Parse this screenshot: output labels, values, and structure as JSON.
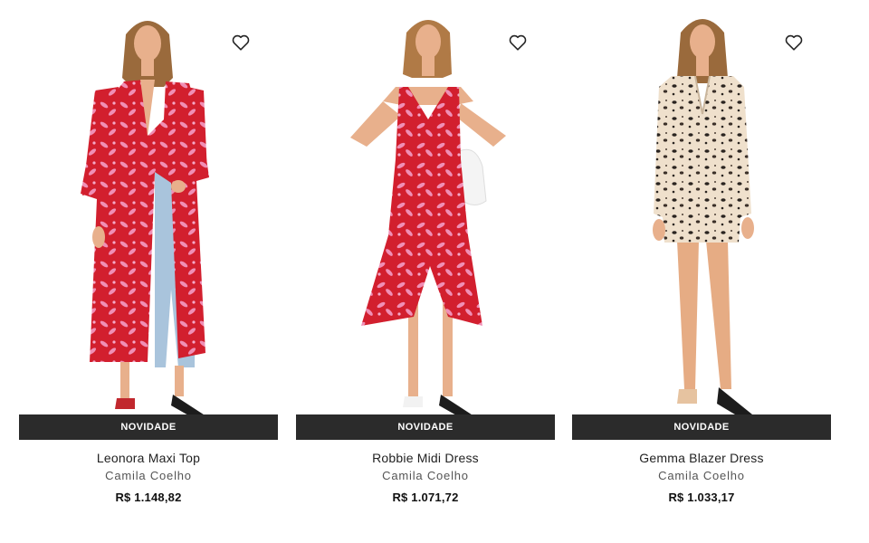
{
  "products": [
    {
      "title": "Leonora Maxi Top",
      "brand": "Camila Coelho",
      "price": "R$ 1.148,82",
      "badge": "NOVIDADE",
      "icon": "heart-outline-icon",
      "garment_color": "#d21f2e",
      "print_color": "#f08fb5"
    },
    {
      "title": "Robbie Midi Dress",
      "brand": "Camila Coelho",
      "price": "R$ 1.071,72",
      "badge": "NOVIDADE",
      "icon": "heart-outline-icon",
      "garment_color": "#d21f2e",
      "print_color": "#f08fb5"
    },
    {
      "title": "Gemma Blazer Dress",
      "brand": "Camila Coelho",
      "price": "R$ 1.033,17",
      "badge": "NOVIDADE",
      "icon": "heart-outline-icon",
      "garment_color": "#efe0cc",
      "print_color": "#2a2420"
    }
  ],
  "colors": {
    "badge_bg": "#2b2b2b",
    "badge_text": "#ffffff",
    "skin": "#e8b08c",
    "hair": "#9a6a3c"
  }
}
